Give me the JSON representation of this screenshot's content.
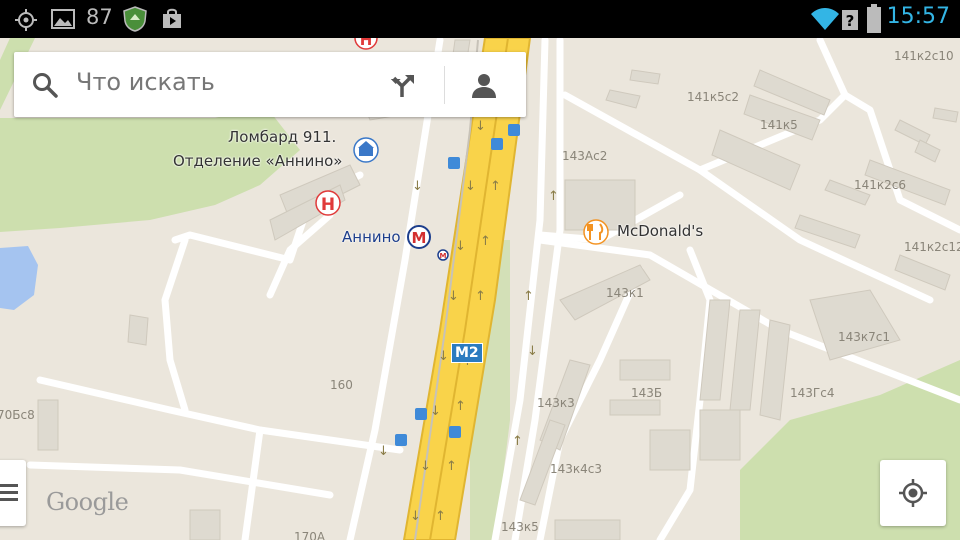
{
  "status_bar": {
    "battery_level": "87",
    "time": "15:57",
    "icons": [
      "gps-icon",
      "image-icon",
      "shield-app-icon",
      "play-store-icon",
      "wifi-icon",
      "no-sim-icon",
      "battery-icon"
    ]
  },
  "search": {
    "placeholder": "Что искать",
    "icons": [
      "search-icon",
      "directions-icon",
      "account-icon"
    ]
  },
  "map": {
    "poi": {
      "lombard_line1": "Ломбард 911.",
      "lombard_line2": "Отделение «Аннино»",
      "metro_station": "Аннино",
      "mcdonalds": "McDonald's"
    },
    "road_shield": "M2",
    "buildings": {
      "b1": "141к2с10",
      "b2": "141к5с2",
      "b3": "141к5",
      "b4": "143Ас2",
      "b5": "141к2с6",
      "b6": "141к2с12",
      "b7": "143к1",
      "b8": "143к7с1",
      "b9": "160",
      "b10": "143Б",
      "b11": "143Гс4",
      "b12": "143к3",
      "b13": "143к4с3",
      "b14": "143к5",
      "b15": "70Бс8",
      "b16": "170А"
    },
    "attribution": "Google"
  },
  "colors": {
    "status_bar_bg": "#000000",
    "clock": "#33b5e5",
    "map_bg": "#ebe6dc",
    "highway": "#f9d34a",
    "park": "#cddfae",
    "water": "#a5c4f0",
    "metro": "#d32f2f",
    "transit_stop": "#3f8ad8"
  }
}
